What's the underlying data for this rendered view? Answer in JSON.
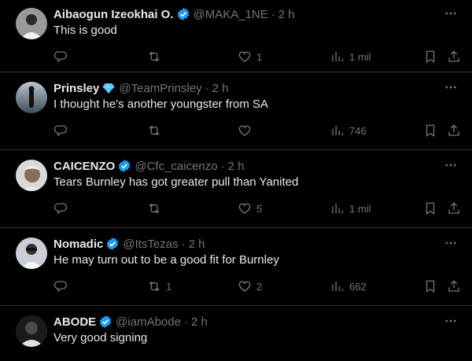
{
  "tweets": [
    {
      "name": "Aibaogun Izeokhai O.",
      "badge": "verified-badge",
      "handle": "@MAKA_1NE",
      "time": "2 h",
      "text": "This is good",
      "replies": "",
      "retweets": "",
      "likes": "1",
      "views": "1 mil"
    },
    {
      "name": "Prinsley",
      "badge": "diamond-badge",
      "handle": "@TeamPrinsley",
      "time": "2 h",
      "text": "I thought he's another youngster from SA",
      "replies": "",
      "retweets": "",
      "likes": "",
      "views": "746"
    },
    {
      "name": "CAICENZO",
      "badge": "verified-badge",
      "handle": "@Cfc_caicenzo",
      "time": "2 h",
      "text": "Tears Burnley has got greater pull than Yanited",
      "replies": "",
      "retweets": "",
      "likes": "5",
      "views": "1 mil"
    },
    {
      "name": "Nomadic",
      "badge": "verified-badge",
      "handle": "@ItsTezas",
      "time": "2 h",
      "text": "He may turn out to be a good fit for Burnley",
      "replies": "",
      "retweets": "1",
      "likes": "2",
      "views": "662"
    },
    {
      "name": "ABODE",
      "badge": "verified-badge",
      "handle": "@iamAbode",
      "time": "2 h",
      "text": "Very good signing",
      "replies": "",
      "retweets": "",
      "likes": "",
      "views": ""
    }
  ],
  "separator": "·",
  "colors": {
    "background": "#000000",
    "text": "#e7e9ea",
    "muted": "#71767b",
    "divider": "#2f3336",
    "verified": "#1d9bf0"
  }
}
